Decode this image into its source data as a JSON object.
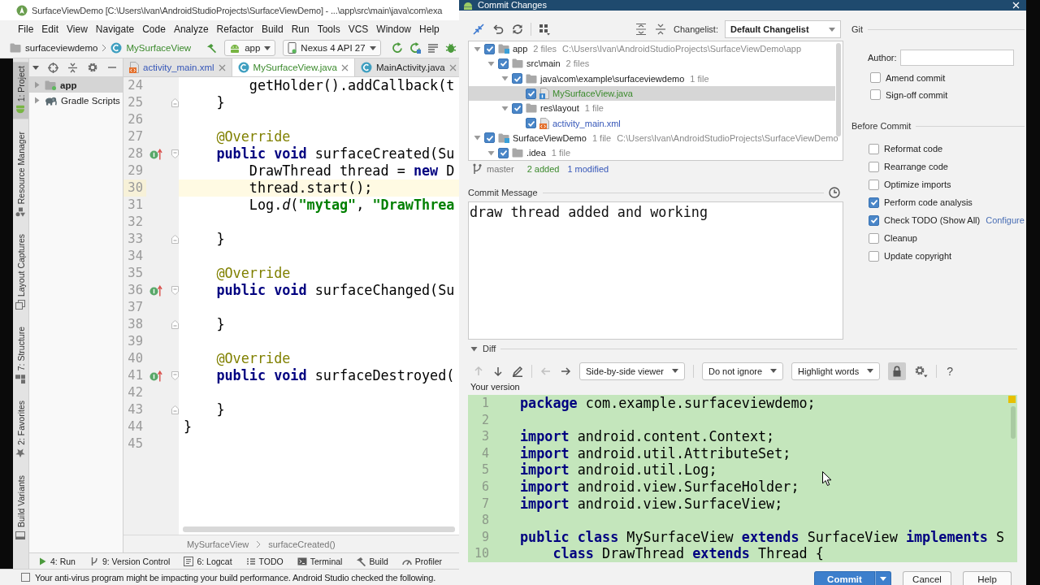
{
  "ide": {
    "title": "SurfaceViewDemo [C:\\Users\\Ivan\\AndroidStudioProjects\\SurfaceViewDemo] - ...\\app\\src\\main\\java\\com\\exa",
    "menu": [
      "File",
      "Edit",
      "View",
      "Navigate",
      "Code",
      "Analyze",
      "Refactor",
      "Build",
      "Run",
      "Tools",
      "VCS",
      "Window",
      "Help"
    ],
    "nav_path": [
      {
        "label": "surfaceviewdemo",
        "kind": "package",
        "color": "#222222"
      },
      {
        "label": "MySurfaceView",
        "kind": "class",
        "color": "#3b8a2c"
      }
    ],
    "run_config": "app",
    "device": "Nexus 4 API 27",
    "side_tabs": [
      {
        "label": "1: Project",
        "kind": "project",
        "selected": true
      },
      {
        "label": "Resource Manager",
        "kind": "resources",
        "selected": false
      },
      {
        "label": "Layout Captures",
        "kind": "captures",
        "selected": false
      },
      {
        "label": "7: Structure",
        "kind": "structure",
        "selected": false
      },
      {
        "label": "2: Favorites",
        "kind": "favorites",
        "selected": false
      },
      {
        "label": "Build Variants",
        "kind": "variants",
        "selected": false
      }
    ],
    "project_tree": [
      {
        "label": "app",
        "kind": "module",
        "expanded": false,
        "selected": true
      },
      {
        "label": "Gradle Scripts",
        "kind": "gradle",
        "expanded": false,
        "selected": false
      }
    ],
    "editor_tabs": [
      {
        "label": "activity_main.xml",
        "kind": "xml",
        "color": "#3556b8",
        "selected": false
      },
      {
        "label": "MySurfaceView.java",
        "kind": "class",
        "color": "#3b8a2c",
        "selected": true
      },
      {
        "label": "MainActivity.java",
        "kind": "class",
        "color": "#222222",
        "selected": false
      }
    ],
    "code_lines": [
      {
        "number": "24",
        "current": false,
        "marker": false,
        "fold_start": false,
        "fold_end": false,
        "tokens": [
          {
            "text": "        getHolder().addCallback(t",
            "kind": "plain"
          }
        ]
      },
      {
        "number": "25",
        "current": false,
        "marker": false,
        "fold_start": false,
        "fold_end": true,
        "tokens": [
          {
            "text": "    }",
            "kind": "plain"
          }
        ]
      },
      {
        "number": "26",
        "current": false,
        "marker": false,
        "fold_start": false,
        "fold_end": false
      },
      {
        "number": "27",
        "current": false,
        "marker": false,
        "fold_start": false,
        "fold_end": false,
        "tokens": [
          {
            "text": "    @Override",
            "kind": "annotation"
          }
        ]
      },
      {
        "number": "28",
        "current": false,
        "marker": true,
        "fold_start": true,
        "fold_end": false,
        "tokens": [
          {
            "text": "    public void",
            "kind": "keyword"
          },
          {
            "text": " surfaceCreated(Su",
            "kind": "plain"
          }
        ]
      },
      {
        "number": "29",
        "current": false,
        "marker": false,
        "fold_start": false,
        "fold_end": false,
        "tokens": [
          {
            "text": "        DrawThread thread = ",
            "kind": "plain"
          },
          {
            "text": "new",
            "kind": "keyword"
          },
          {
            "text": " D",
            "kind": "plain"
          }
        ]
      },
      {
        "number": "30",
        "current": true,
        "marker": false,
        "fold_start": false,
        "fold_end": false,
        "tokens": [
          {
            "text": "        thread.start();",
            "kind": "plain"
          }
        ]
      },
      {
        "number": "31",
        "current": false,
        "marker": false,
        "fold_start": false,
        "fold_end": false,
        "tokens": [
          {
            "text": "        Log.",
            "kind": "plain"
          },
          {
            "text": "d",
            "kind": "static_call"
          },
          {
            "text": "(",
            "kind": "plain"
          },
          {
            "text": "\"mytag\"",
            "kind": "string"
          },
          {
            "text": ", ",
            "kind": "plain"
          },
          {
            "text": "\"DrawThrea",
            "kind": "string"
          }
        ]
      },
      {
        "number": "32",
        "current": false,
        "marker": false,
        "fold_start": false,
        "fold_end": false
      },
      {
        "number": "33",
        "current": false,
        "marker": false,
        "fold_start": false,
        "fold_end": true,
        "tokens": [
          {
            "text": "    }",
            "kind": "plain"
          }
        ]
      },
      {
        "number": "34",
        "current": false,
        "marker": false,
        "fold_start": false,
        "fold_end": false
      },
      {
        "number": "35",
        "current": false,
        "marker": false,
        "fold_start": false,
        "fold_end": false,
        "tokens": [
          {
            "text": "    @Override",
            "kind": "annotation"
          }
        ]
      },
      {
        "number": "36",
        "current": false,
        "marker": true,
        "fold_start": true,
        "fold_end": false,
        "tokens": [
          {
            "text": "    public void",
            "kind": "keyword"
          },
          {
            "text": " surfaceChanged(Su",
            "kind": "plain"
          }
        ]
      },
      {
        "number": "37",
        "current": false,
        "marker": false,
        "fold_start": false,
        "fold_end": false
      },
      {
        "number": "38",
        "current": false,
        "marker": false,
        "fold_start": false,
        "fold_end": true,
        "tokens": [
          {
            "text": "    }",
            "kind": "plain"
          }
        ]
      },
      {
        "number": "39",
        "current": false,
        "marker": false,
        "fold_start": false,
        "fold_end": false
      },
      {
        "number": "40",
        "current": false,
        "marker": false,
        "fold_start": false,
        "fold_end": false,
        "tokens": [
          {
            "text": "    @Override",
            "kind": "annotation"
          }
        ]
      },
      {
        "number": "41",
        "current": false,
        "marker": true,
        "fold_start": true,
        "fold_end": false,
        "tokens": [
          {
            "text": "    public void",
            "kind": "keyword"
          },
          {
            "text": " surfaceDestroyed(",
            "kind": "plain"
          }
        ]
      },
      {
        "number": "42",
        "current": false,
        "marker": false,
        "fold_start": false,
        "fold_end": false
      },
      {
        "number": "43",
        "current": false,
        "marker": false,
        "fold_start": false,
        "fold_end": true,
        "tokens": [
          {
            "text": "    }",
            "kind": "plain"
          }
        ]
      },
      {
        "number": "44",
        "current": false,
        "marker": false,
        "fold_start": false,
        "fold_end": false,
        "tokens": [
          {
            "text": "}",
            "kind": "plain"
          }
        ]
      },
      {
        "number": "45",
        "current": false,
        "marker": false,
        "fold_start": false,
        "fold_end": false
      }
    ],
    "breadcrumbs": [
      "MySurfaceView",
      "surfaceCreated()"
    ],
    "tool_tabs": [
      {
        "label": "4: Run",
        "kind": "run"
      },
      {
        "label": "9: Version Control",
        "kind": "vcs"
      },
      {
        "label": "6: Logcat",
        "kind": "logcat"
      },
      {
        "label": "TODO",
        "kind": "todo"
      },
      {
        "label": "Terminal",
        "kind": "terminal"
      },
      {
        "label": "Build",
        "kind": "build"
      },
      {
        "label": "Profiler",
        "kind": "profiler"
      }
    ],
    "status_message": "Your anti-virus program might be impacting your build performance. Android Studio checked the following."
  },
  "dialog": {
    "title": "Commit Changes",
    "changelist": {
      "label": "Changelist:",
      "value": "Default Changelist"
    },
    "tree": [
      {
        "name": "app",
        "kind": "module",
        "count": "2 files",
        "path": "C:\\Users\\Ivan\\AndroidStudioProjects\\SurfaceViewDemo\\app",
        "checked": true,
        "expanded": true,
        "selected": false,
        "children": [
          {
            "name": "src\\main",
            "kind": "folder",
            "count": "2 files",
            "checked": true,
            "expanded": true,
            "selected": false,
            "children": [
              {
                "name": "java\\com\\example\\surfaceviewdemo",
                "kind": "folder",
                "count": "1 file",
                "checked": true,
                "expanded": true,
                "selected": false,
                "children": [
                  {
                    "name": "MySurfaceView.java",
                    "kind": "java",
                    "color": "#3b8a2c",
                    "checked": true,
                    "selected": true
                  }
                ]
              },
              {
                "name": "res\\layout",
                "kind": "folder",
                "count": "1 file",
                "checked": true,
                "expanded": true,
                "selected": false,
                "children": [
                  {
                    "name": "activity_main.xml",
                    "kind": "xml",
                    "color": "#3556b8",
                    "checked": true,
                    "selected": false
                  }
                ]
              }
            ]
          }
        ]
      },
      {
        "name": "SurfaceViewDemo",
        "kind": "module",
        "count": "1 file",
        "path": "C:\\Users\\Ivan\\AndroidStudioProjects\\SurfaceViewDemo",
        "checked": true,
        "expanded": true,
        "selected": false,
        "children": [
          {
            "name": ".idea",
            "kind": "folder",
            "count": "1 file",
            "checked": true,
            "expanded": true,
            "selected": false
          }
        ]
      }
    ],
    "summary": {
      "branch": "master",
      "added": "2 added",
      "modified": "1 modified"
    },
    "message": {
      "label": "Commit Message",
      "value": "draw thread added and working"
    },
    "git": {
      "label": "Git",
      "author_label": "Author:",
      "options": [
        {
          "label": "Amend commit",
          "checked": false
        },
        {
          "label": "Sign-off commit",
          "checked": false
        }
      ]
    },
    "before_commit": {
      "label": "Before Commit",
      "options": [
        {
          "label": "Reformat code",
          "checked": false
        },
        {
          "label": "Rearrange code",
          "checked": false
        },
        {
          "label": "Optimize imports",
          "checked": false
        },
        {
          "label": "Perform code analysis",
          "checked": true
        },
        {
          "label": "Check TODO (Show All)",
          "checked": true,
          "link": "Configure"
        },
        {
          "label": "Cleanup",
          "checked": false
        },
        {
          "label": "Update copyright",
          "checked": false
        }
      ]
    },
    "diff": {
      "label": "Diff",
      "expanded": true,
      "nav_buttons": [
        {
          "kind": "up",
          "disabled": true
        },
        {
          "kind": "down",
          "disabled": false
        },
        {
          "kind": "edit",
          "disabled": false
        },
        {
          "kind": "back",
          "disabled": true
        },
        {
          "kind": "forward",
          "disabled": false
        }
      ],
      "viewer": "Side-by-side viewer",
      "ignore_mode": "Do not ignore",
      "highlight_mode": "Highlight words",
      "locked": true,
      "help": "?",
      "version_label": "Your version",
      "lines": [
        {
          "number": "1",
          "tokens": [
            {
              "text": "package",
              "kind": "keyword"
            },
            {
              "text": " com.example.surfaceviewdemo;",
              "kind": "plain"
            }
          ]
        },
        {
          "number": "2"
        },
        {
          "number": "3",
          "tokens": [
            {
              "text": "import",
              "kind": "keyword"
            },
            {
              "text": " android.content.Context;",
              "kind": "plain"
            }
          ]
        },
        {
          "number": "4",
          "tokens": [
            {
              "text": "import",
              "kind": "keyword"
            },
            {
              "text": " android.util.AttributeSet;",
              "kind": "plain"
            }
          ]
        },
        {
          "number": "5",
          "tokens": [
            {
              "text": "import",
              "kind": "keyword"
            },
            {
              "text": " android.util.Log;",
              "kind": "plain"
            }
          ]
        },
        {
          "number": "6",
          "tokens": [
            {
              "text": "import",
              "kind": "keyword"
            },
            {
              "text": " android.view.SurfaceHolder;",
              "kind": "plain"
            }
          ]
        },
        {
          "number": "7",
          "tokens": [
            {
              "text": "import",
              "kind": "keyword"
            },
            {
              "text": " android.view.SurfaceView;",
              "kind": "plain"
            }
          ]
        },
        {
          "number": "8"
        },
        {
          "number": "9",
          "tokens": [
            {
              "text": "public class",
              "kind": "keyword"
            },
            {
              "text": " MySurfaceView ",
              "kind": "plain"
            },
            {
              "text": "extends",
              "kind": "keyword"
            },
            {
              "text": " SurfaceView ",
              "kind": "plain"
            },
            {
              "text": "implements",
              "kind": "keyword"
            },
            {
              "text": " S",
              "kind": "plain"
            }
          ]
        },
        {
          "number": "10",
          "tokens": [
            {
              "text": "    class",
              "kind": "keyword"
            },
            {
              "text": " DrawThread ",
              "kind": "plain"
            },
            {
              "text": "extends",
              "kind": "keyword"
            },
            {
              "text": " Thread {",
              "kind": "plain"
            }
          ]
        }
      ]
    },
    "buttons": [
      {
        "label": "Commit",
        "kind": "primary"
      },
      {
        "label": "Cancel",
        "kind": "secondary"
      },
      {
        "label": "Help",
        "kind": "secondary"
      }
    ]
  }
}
